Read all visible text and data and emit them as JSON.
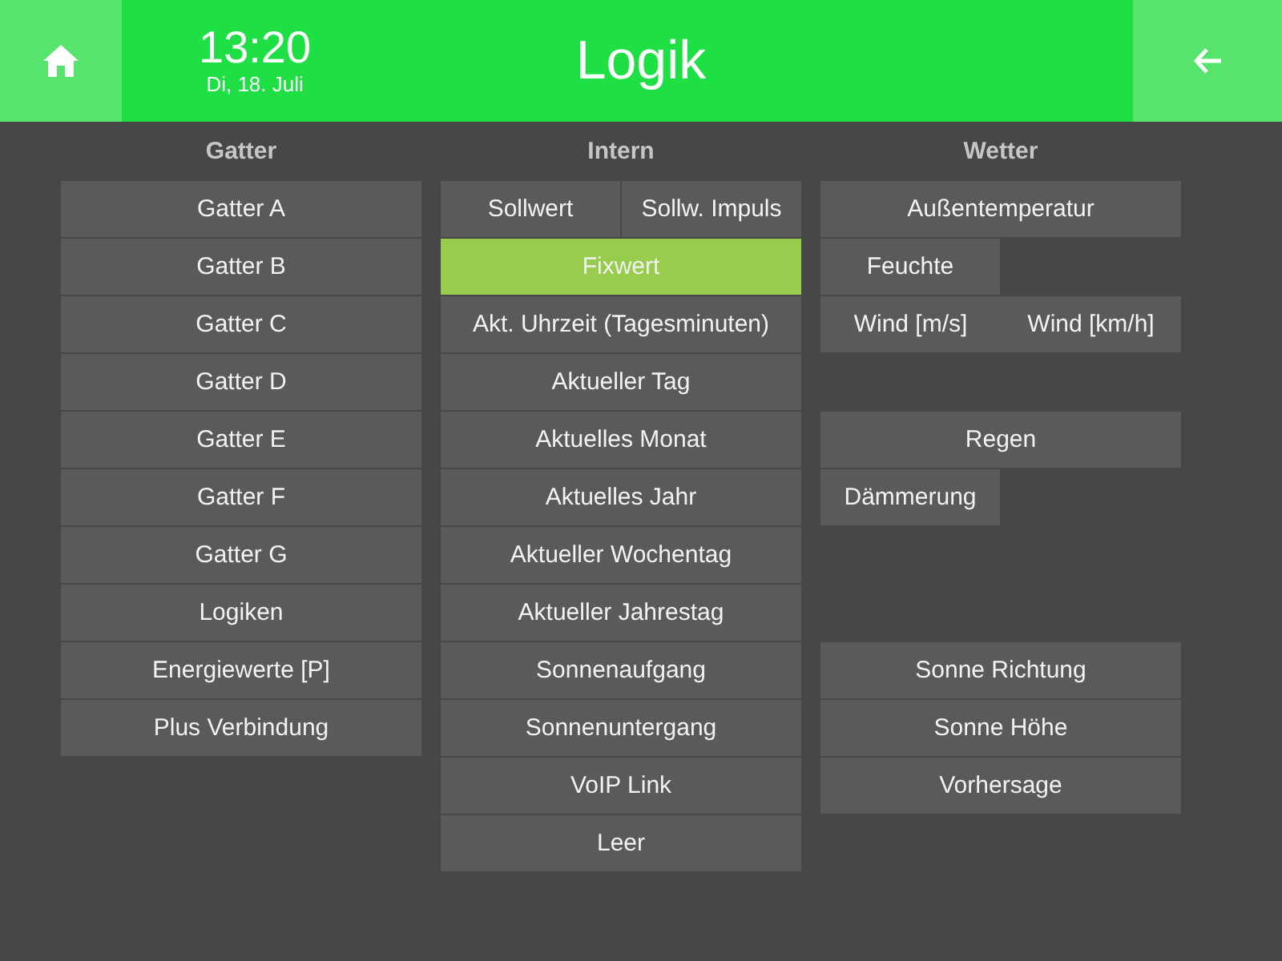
{
  "header": {
    "time": "13:20",
    "date": "Di, 18. Juli",
    "title": "Logik"
  },
  "columns": [
    {
      "heading": "Gatter",
      "rows": [
        {
          "kind": "wide",
          "buttons": [
            {
              "label": "Gatter A",
              "selected": false
            }
          ]
        },
        {
          "kind": "wide",
          "buttons": [
            {
              "label": "Gatter B",
              "selected": false
            }
          ]
        },
        {
          "kind": "wide",
          "buttons": [
            {
              "label": "Gatter C",
              "selected": false
            }
          ]
        },
        {
          "kind": "wide",
          "buttons": [
            {
              "label": "Gatter D",
              "selected": false
            }
          ]
        },
        {
          "kind": "wide",
          "buttons": [
            {
              "label": "Gatter E",
              "selected": false
            }
          ]
        },
        {
          "kind": "wide",
          "buttons": [
            {
              "label": "Gatter F",
              "selected": false
            }
          ]
        },
        {
          "kind": "wide",
          "buttons": [
            {
              "label": "Gatter G",
              "selected": false
            }
          ]
        },
        {
          "kind": "wide",
          "buttons": [
            {
              "label": "Logiken",
              "selected": false
            }
          ]
        },
        {
          "kind": "wide",
          "buttons": [
            {
              "label": "Energiewerte [P]",
              "selected": false
            }
          ]
        },
        {
          "kind": "wide",
          "buttons": [
            {
              "label": "Plus Verbindung",
              "selected": false
            }
          ]
        }
      ]
    },
    {
      "heading": "Intern",
      "rows": [
        {
          "kind": "pair",
          "buttons": [
            {
              "label": "Sollwert",
              "selected": false
            },
            {
              "label": "Sollw. Impuls",
              "selected": false
            }
          ]
        },
        {
          "kind": "wide",
          "buttons": [
            {
              "label": "Fixwert",
              "selected": true
            }
          ]
        },
        {
          "kind": "wide",
          "buttons": [
            {
              "label": "Akt. Uhrzeit (Tagesminuten)",
              "selected": false
            }
          ]
        },
        {
          "kind": "wide",
          "buttons": [
            {
              "label": "Aktueller Tag",
              "selected": false
            }
          ]
        },
        {
          "kind": "wide",
          "buttons": [
            {
              "label": "Aktuelles Monat",
              "selected": false
            }
          ]
        },
        {
          "kind": "wide",
          "buttons": [
            {
              "label": "Aktuelles Jahr",
              "selected": false
            }
          ]
        },
        {
          "kind": "wide",
          "buttons": [
            {
              "label": "Aktueller Wochentag",
              "selected": false
            }
          ]
        },
        {
          "kind": "wide",
          "buttons": [
            {
              "label": "Aktueller Jahrestag",
              "selected": false
            }
          ]
        },
        {
          "kind": "wide",
          "buttons": [
            {
              "label": "Sonnenaufgang",
              "selected": false
            }
          ]
        },
        {
          "kind": "wide",
          "buttons": [
            {
              "label": "Sonnenuntergang",
              "selected": false
            }
          ]
        },
        {
          "kind": "wide",
          "buttons": [
            {
              "label": "VoIP Link",
              "selected": false
            }
          ]
        },
        {
          "kind": "wide",
          "buttons": [
            {
              "label": "Leer",
              "selected": false
            }
          ]
        }
      ]
    },
    {
      "heading": "Wetter",
      "rows": [
        {
          "kind": "wide",
          "buttons": [
            {
              "label": "Außentemperatur",
              "selected": false
            }
          ]
        },
        {
          "kind": "half",
          "buttons": [
            {
              "label": "Feuchte",
              "selected": false
            }
          ]
        },
        {
          "kind": "joined",
          "buttons": [
            {
              "label": "Wind [m/s]",
              "selected": false
            },
            {
              "label": "Wind [km/h]",
              "selected": false
            }
          ]
        },
        {
          "kind": "blank"
        },
        {
          "kind": "wide",
          "buttons": [
            {
              "label": "Regen",
              "selected": false
            }
          ]
        },
        {
          "kind": "half",
          "buttons": [
            {
              "label": "Dämmerung",
              "selected": false
            }
          ]
        },
        {
          "kind": "blank"
        },
        {
          "kind": "blank"
        },
        {
          "kind": "wide",
          "buttons": [
            {
              "label": "Sonne Richtung",
              "selected": false
            }
          ]
        },
        {
          "kind": "wide",
          "buttons": [
            {
              "label": "Sonne Höhe",
              "selected": false
            }
          ]
        },
        {
          "kind": "wide",
          "buttons": [
            {
              "label": "Vorhersage",
              "selected": false
            }
          ]
        }
      ]
    }
  ]
}
